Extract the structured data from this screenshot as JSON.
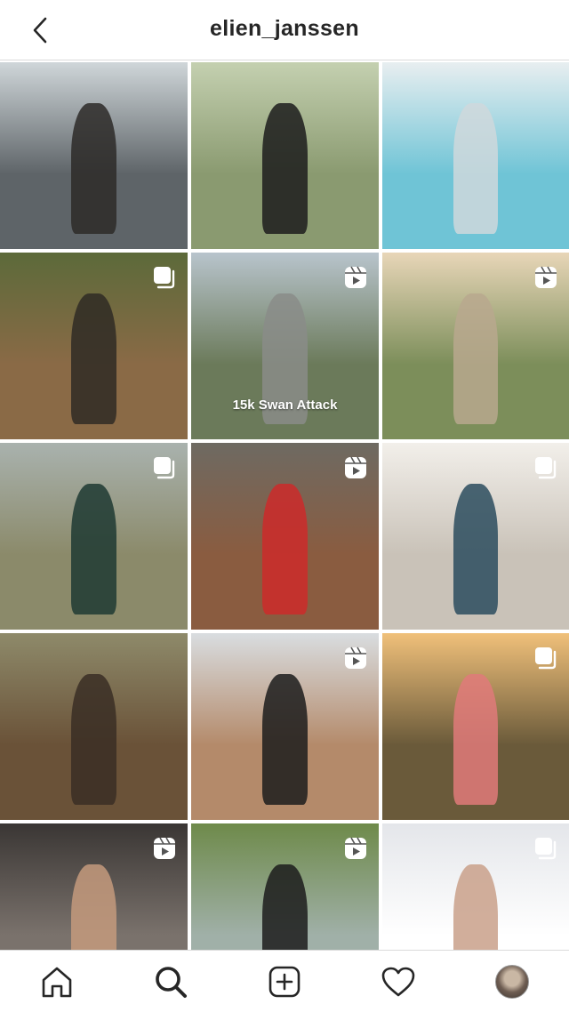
{
  "header": {
    "username": "elien_janssen"
  },
  "icons": {
    "back": "chevron-left-icon",
    "carousel": "carousel-icon",
    "reel": "reel-icon"
  },
  "grid": {
    "tiles": [
      {
        "name": "post-runner-road",
        "badge": "",
        "caption": "",
        "colors": [
          "#cfd6d9",
          "#5e6468",
          "#2d2a28"
        ]
      },
      {
        "name": "post-cycling",
        "badge": "",
        "caption": "",
        "colors": [
          "#c4d0b0",
          "#8a9a70",
          "#1c1c1c"
        ]
      },
      {
        "name": "post-pool",
        "badge": "",
        "caption": "",
        "colors": [
          "#e8eef0",
          "#6fc4d6",
          "#cfd8dc"
        ]
      },
      {
        "name": "post-forest-trail",
        "badge": "carousel",
        "caption": "",
        "colors": [
          "#5c6a3a",
          "#8a6a46",
          "#2f2a24"
        ]
      },
      {
        "name": "post-swan-attack",
        "badge": "reel",
        "caption": "15k Swan Attack",
        "colors": [
          "#b8c4cc",
          "#6b7a5a",
          "#8a8c88"
        ]
      },
      {
        "name": "post-park-path",
        "badge": "reel",
        "caption": "",
        "colors": [
          "#e8d6b8",
          "#7c8e5a",
          "#b9a88e"
        ]
      },
      {
        "name": "post-green-jacket",
        "badge": "carousel",
        "caption": "",
        "colors": [
          "#a9b2ae",
          "#8b8a6a",
          "#1f3a33"
        ]
      },
      {
        "name": "post-dog-road",
        "badge": "reel",
        "caption": "",
        "colors": [
          "#6e6a62",
          "#8a5c40",
          "#cc2a2a"
        ]
      },
      {
        "name": "post-living-room",
        "badge": "carousel",
        "caption": "",
        "colors": [
          "#f2efea",
          "#c9c2b8",
          "#2c4c5e"
        ]
      },
      {
        "name": "post-dog-portrait",
        "badge": "",
        "caption": "",
        "colors": [
          "#8e8a6a",
          "#6a5238",
          "#3a2e24"
        ]
      },
      {
        "name": "post-abs",
        "badge": "reel",
        "caption": "",
        "colors": [
          "#d9dde0",
          "#b48a6a",
          "#1c1c1c"
        ]
      },
      {
        "name": "post-sunset-field",
        "badge": "carousel",
        "caption": "",
        "colors": [
          "#f0c07a",
          "#6a5a3a",
          "#e07a7a"
        ]
      },
      {
        "name": "post-treadmill",
        "badge": "reel",
        "caption": "",
        "colors": [
          "#3a3634",
          "#7a726c",
          "#c49a7c"
        ]
      },
      {
        "name": "post-canal-dog",
        "badge": "reel",
        "caption": "",
        "colors": [
          "#6e8a4a",
          "#a0b0a8",
          "#1c1c1c"
        ]
      },
      {
        "name": "post-girl-power",
        "badge": "carousel",
        "caption": "",
        "colors": [
          "#e4e6ea",
          "#ffffff",
          "#c9a08a"
        ]
      }
    ]
  },
  "tabbar": {
    "items": [
      {
        "name": "tab-home",
        "icon": "home-icon"
      },
      {
        "name": "tab-search",
        "icon": "search-icon"
      },
      {
        "name": "tab-create",
        "icon": "plus-square-icon"
      },
      {
        "name": "tab-activity",
        "icon": "heart-icon"
      },
      {
        "name": "tab-profile",
        "icon": "avatar"
      }
    ]
  }
}
